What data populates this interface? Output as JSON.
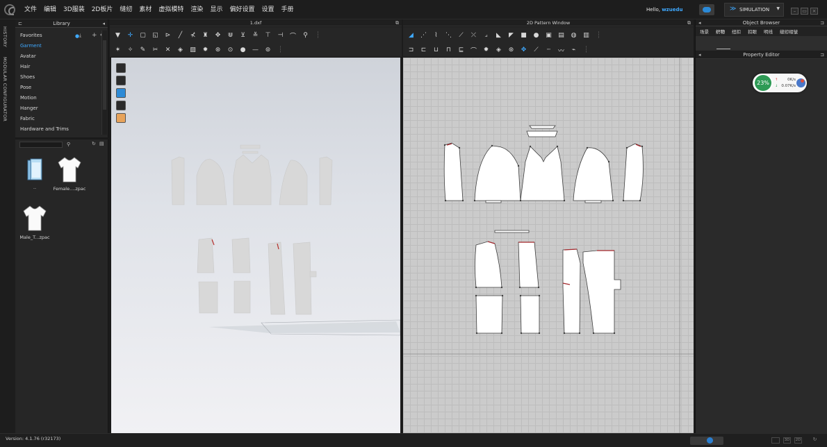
{
  "menu": {
    "items": [
      "文件",
      "编辑",
      "3D服装",
      "2D板片",
      "缝纫",
      "素材",
      "虚拟模特",
      "渲染",
      "显示",
      "偏好设置",
      "设置",
      "手册"
    ],
    "greeting": "Hello, ",
    "username": "wzuedu",
    "simulation_label": "SIMULATION"
  },
  "side_tabs": [
    "HISTORY",
    "MODULAR CONFIGURATOR"
  ],
  "library": {
    "title": "Library",
    "items": [
      "Favorites",
      "Garment",
      "Avatar",
      "Hair",
      "Shoes",
      "Pose",
      "Motion",
      "Hanger",
      "Fabric",
      "Hardware and Trims"
    ],
    "active_item": "Garment",
    "thumbnails": [
      {
        "caption": "..",
        "icon": "folder-icon"
      },
      {
        "caption": "Female....zpac",
        "icon": "tshirt-icon"
      },
      {
        "caption": "Male_T...zpac",
        "icon": "tshirt-icon"
      }
    ]
  },
  "viewport3d": {
    "title": "1.dxf"
  },
  "pattern2d": {
    "title": "2D Pattern Window"
  },
  "object_browser": {
    "title": "Object Browser",
    "tabs": [
      "场景",
      "织物",
      "纽扣",
      "扣眼",
      "明线",
      "缝纫褶皱"
    ],
    "active_tab": "织物"
  },
  "property_editor": {
    "title": "Property Editor"
  },
  "net_widget": {
    "percent": "23%",
    "up": "0K/s",
    "down": "0.07K/s"
  },
  "status": {
    "version": "Version: 4.1.76 (r32173)"
  },
  "colors": {
    "accent": "#3fa9ff",
    "net_green": "#2e9a55"
  }
}
